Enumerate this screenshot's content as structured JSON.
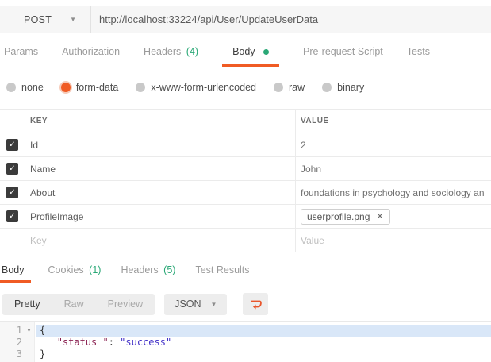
{
  "icons": {
    "check": "✓",
    "caret_down": "▼",
    "fold_caret": "▾",
    "close": "✕"
  },
  "colors": {
    "accent_orange": "#f05b24",
    "accent_green": "#2aa876",
    "code_key": "#8b2252",
    "code_string": "#4331c8",
    "line_highlight": "#d9e7f8",
    "checkbox_dark": "#3b3b3b"
  },
  "request": {
    "method": "POST",
    "url": "http://localhost:33224/api/User/UpdateUserData",
    "tabs": [
      {
        "label": "Params"
      },
      {
        "label": "Authorization"
      },
      {
        "label": "Headers",
        "count": "(4)"
      },
      {
        "label": "Body"
      },
      {
        "label": "Pre-request Script"
      },
      {
        "label": "Tests"
      }
    ],
    "active_tab": "Body",
    "body_modes": [
      {
        "label": "none"
      },
      {
        "label": "form-data"
      },
      {
        "label": "x-www-form-urlencoded"
      },
      {
        "label": "raw"
      },
      {
        "label": "binary"
      }
    ],
    "selected_body_mode": "form-data",
    "form_table": {
      "headers": {
        "key": "KEY",
        "value": "VALUE"
      },
      "rows": [
        {
          "key": "Id",
          "value": "2",
          "checked": true
        },
        {
          "key": "Name",
          "value": "John",
          "checked": true
        },
        {
          "key": "About",
          "value": "foundations in psychology and sociology an",
          "checked": true
        },
        {
          "key": "ProfileImage",
          "value": "userprofile.png",
          "checked": true,
          "type": "file"
        }
      ],
      "placeholder_row": {
        "key": "Key",
        "value": "Value"
      }
    }
  },
  "response": {
    "tabs": [
      {
        "label": "Body"
      },
      {
        "label": "Cookies",
        "count": "(1)"
      },
      {
        "label": "Headers",
        "count": "(5)"
      },
      {
        "label": "Test Results"
      }
    ],
    "active_tab": "Body",
    "view_modes": [
      "Pretty",
      "Raw",
      "Preview"
    ],
    "active_view_mode": "Pretty",
    "language": "JSON",
    "code_lines": [
      {
        "num": "1",
        "brace": "{",
        "foldable": true,
        "highlighted": true
      },
      {
        "num": "2",
        "indent": "   ",
        "key": "\"status \"",
        "sep": ": ",
        "value": "\"success\""
      },
      {
        "num": "3",
        "brace": "}"
      }
    ]
  }
}
